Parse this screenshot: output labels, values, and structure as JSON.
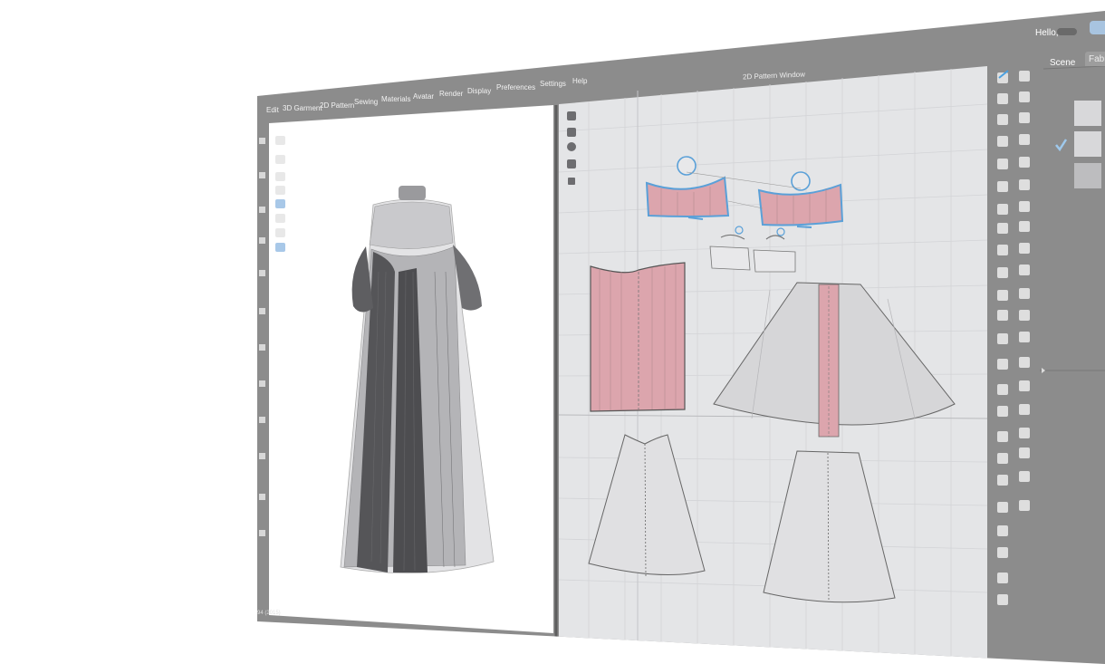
{
  "menubar": {
    "items": [
      "Edit",
      "3D Garment",
      "2D Pattern",
      "Sewing",
      "Materials",
      "Avatar",
      "Render",
      "Display",
      "Preferences",
      "Settings",
      "Help"
    ]
  },
  "user": {
    "greeting": "Hello,"
  },
  "pattern_window": {
    "title": "2D Pattern Window"
  },
  "right_panel": {
    "tabs": [
      "Scene",
      "Fabric"
    ]
  },
  "status_bar": {
    "text": "94 (2015)"
  },
  "colors": {
    "chrome": "#8c8c8c",
    "viewport_3d": "#ffffff",
    "pattern_bg": "#e4e5e7",
    "pattern_fill": "#d6d6d8",
    "stretch_highlight": "#dca5ad",
    "selected_outline": "#5aa0d8",
    "check": "#9fc9ec"
  },
  "icons": {
    "left_toolbar": [
      "select-mesh-icon",
      "move-icon",
      "pin-icon",
      "draw-icon",
      "fold-icon",
      "arrange-icon",
      "zip-icon",
      "avatar-icon",
      "light-icon"
    ],
    "pattern_toolbar": [
      "transform-icon",
      "edit-point-icon",
      "info-icon",
      "texture-icon",
      "lock-icon"
    ],
    "right_toolbar": [
      "polygon-icon",
      "rectangle-icon",
      "internal-polygon-icon",
      "circle-icon",
      "dart-icon",
      "trace-icon",
      "seam-icon",
      "segment-sewing-icon",
      "free-sewing-icon",
      "tack-icon",
      "text-icon",
      "annotation-icon",
      "grading-icon",
      "ruler-icon"
    ]
  }
}
